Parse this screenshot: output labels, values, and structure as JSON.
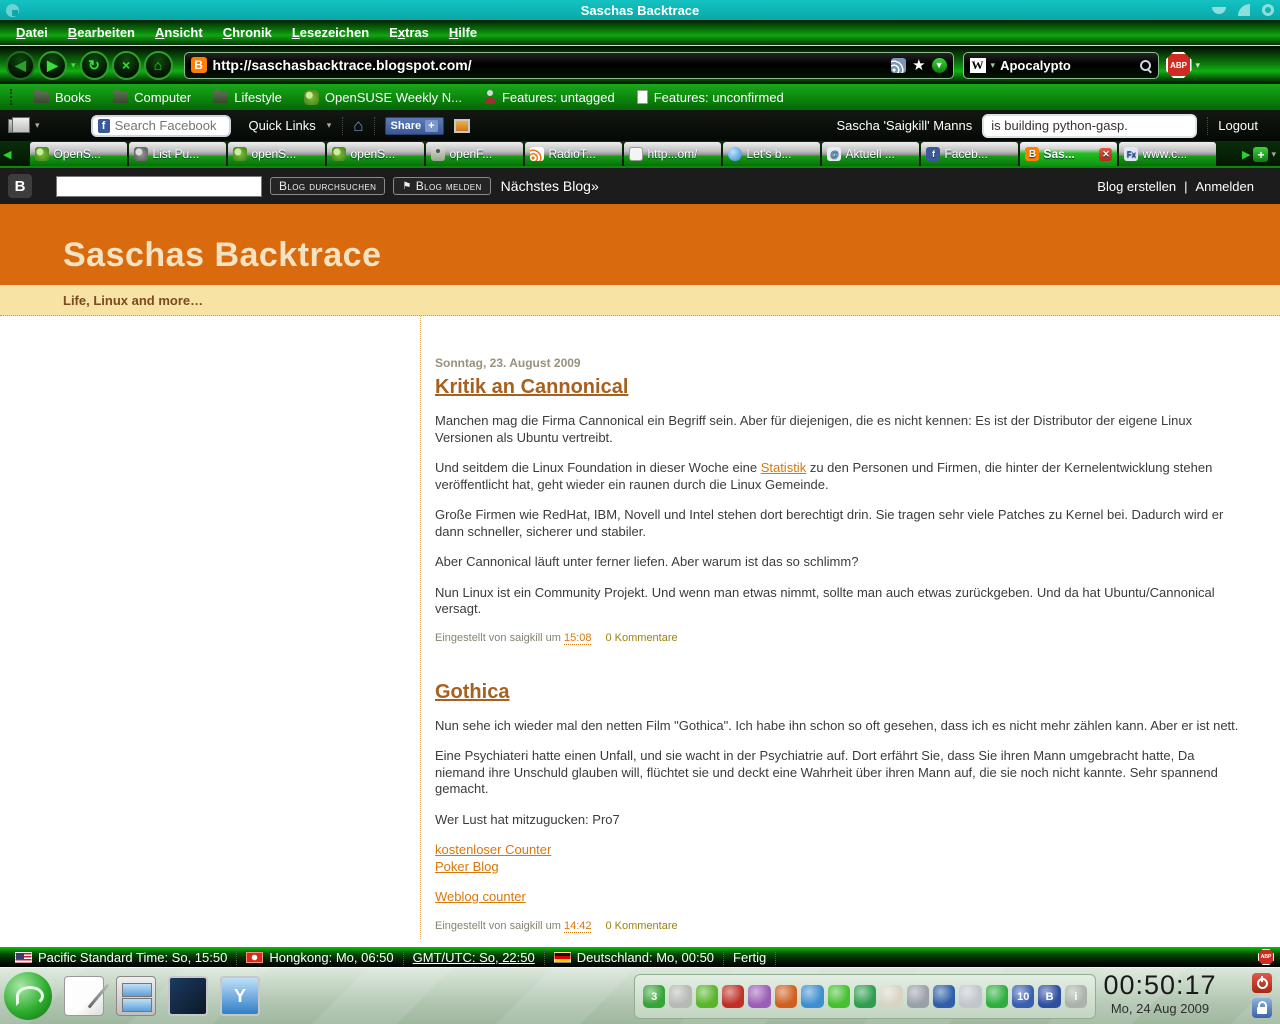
{
  "window": {
    "title": "Saschas Backtrace",
    "menus": [
      {
        "label": "Datei",
        "accel": 0
      },
      {
        "label": "Bearbeiten",
        "accel": 0
      },
      {
        "label": "Ansicht",
        "accel": 0
      },
      {
        "label": "Chronik",
        "accel": 0
      },
      {
        "label": "Lesezeichen",
        "accel": 0
      },
      {
        "label": "Extras",
        "accel": 1
      },
      {
        "label": "Hilfe",
        "accel": 0
      }
    ]
  },
  "nav": {
    "url": "http://saschasbacktrace.blogspot.com/",
    "search_engine": "W",
    "search_value": "Apocalypto",
    "abp_label": "ABP"
  },
  "bookmarks": [
    {
      "label": "Books",
      "icon": "folder"
    },
    {
      "label": "Computer",
      "icon": "folder"
    },
    {
      "label": "Lifestyle",
      "icon": "folder"
    },
    {
      "label": "OpenSUSE Weekly N...",
      "icon": "suse"
    },
    {
      "label": "Features: untagged",
      "icon": "person"
    },
    {
      "label": "Features: unconfirmed",
      "icon": "page"
    }
  ],
  "facebook_bar": {
    "search_placeholder": "Search Facebook",
    "quick_links": "Quick Links",
    "share": "Share",
    "plus": "+",
    "user": "Sascha 'Saigkill' Manns",
    "status_value": "is building python-gasp.",
    "logout": "Logout"
  },
  "tabs": [
    {
      "label": "OpenS...",
      "icon": "suse"
    },
    {
      "label": "List Pu...",
      "icon": "suse-gray"
    },
    {
      "label": "openS...",
      "icon": "suse"
    },
    {
      "label": "openS...",
      "icon": "suse"
    },
    {
      "label": "openF...",
      "icon": "fate"
    },
    {
      "label": "RadioT...",
      "icon": "rss"
    },
    {
      "label": "http...om/",
      "icon": "page"
    },
    {
      "label": "Let's b...",
      "icon": "globe"
    },
    {
      "label": "Aktuell ...",
      "icon": "chat",
      "glyph": "@"
    },
    {
      "label": "Faceb...",
      "icon": "facebook",
      "glyph": "f"
    },
    {
      "label": "Sas...",
      "icon": "blogger",
      "glyph": "B",
      "active": true
    },
    {
      "label": "www.c...",
      "icon": "fx",
      "glyph": "Fx"
    }
  ],
  "blogger_navbar": {
    "logo": "B",
    "search_value": "",
    "search_button": "Blog durchsuchen",
    "flag_glyph": "⚑",
    "flag_button": "Blog melden",
    "next_blog": "Nächstes Blog»",
    "create_blog": "Blog erstellen",
    "divider": "|",
    "sign_in": "Anmelden"
  },
  "blog": {
    "title": "Saschas Backtrace",
    "subtitle": "Life, Linux and more…",
    "posts": [
      {
        "date": "Sonntag, 23. August 2009",
        "title": "Kritik an Cannonical",
        "paragraphs": [
          [
            {
              "text": "Manchen mag die Firma Cannonical ein Begriff sein. Aber für diejenigen, die es nicht kennen: Es ist der Distributor der eigene Linux Versionen als Ubuntu vertreibt."
            }
          ],
          [
            {
              "text": "Und seitdem die Linux Foundation in dieser Woche eine "
            },
            {
              "text": "Statistik",
              "link": true
            },
            {
              "text": " zu den Personen und Firmen, die hinter der Kernelentwicklung stehen veröffentlicht hat, geht wieder ein raunen durch die Linux Gemeinde."
            }
          ],
          [
            {
              "text": "Große Firmen wie RedHat, IBM, Novell und Intel stehen dort berechtigt drin. Sie tragen sehr viele Patches zu Kernel bei. Dadurch wird er dann schneller, sicherer und stabiler."
            }
          ],
          [
            {
              "text": "Aber Cannonical läuft unter ferner liefen. Aber warum ist das so schlimm?"
            }
          ],
          [
            {
              "text": "Nun Linux ist ein Community Projekt. Und wenn man etwas nimmt, sollte man auch etwas zurückgeben. Und da hat Ubuntu/Cannonical versagt."
            }
          ]
        ],
        "footer": {
          "prefix": "Eingestellt von saigkill um",
          "time": "15:08",
          "comments": "0 Kommentare"
        }
      },
      {
        "date": "",
        "title": "Gothica",
        "paragraphs": [
          [
            {
              "text": "Nun sehe ich wieder mal den netten Film \"Gothica\". Ich habe ihn schon so oft gesehen, dass ich es nicht mehr zählen kann. Aber er ist nett."
            }
          ],
          [
            {
              "text": "Eine Psychiateri hatte einen Unfall, und sie wacht in der Psychiatrie auf. Dort erfährt Sie, dass Sie ihren Mann umgebracht hatte, Da niemand ihre Unschuld glauben will, flüchtet sie und deckt eine Wahrheit über ihren Mann auf, die sie noch nicht kannte. Sehr spannend gemacht."
            }
          ],
          [
            {
              "text": "Wer Lust hat mitzugucken: Pro7"
            }
          ],
          [
            {
              "text": "kostenloser Counter",
              "link": true
            },
            {
              "br": true
            },
            {
              "text": "Poker Blog",
              "link": true
            }
          ],
          [
            {
              "text": "Weblog counter",
              "link": true
            }
          ]
        ],
        "footer": {
          "prefix": "Eingestellt von saigkill um",
          "time": "14:42",
          "comments": "0 Kommentare"
        }
      }
    ]
  },
  "statusbar": {
    "items": [
      {
        "flag": "us",
        "text": "Pacific Standard Time: So, 15:50"
      },
      {
        "flag": "hk",
        "text": "Hongkong: Mo, 06:50"
      },
      {
        "flag": null,
        "text": "GMT/UTC: So, 22:50",
        "underline": true
      },
      {
        "flag": "de",
        "text": "Deutschland: Mo, 00:50"
      },
      {
        "flag": null,
        "text": "Fertig"
      }
    ],
    "abp_label": "ABP"
  },
  "taskbar": {
    "clock_time": "00:50:17",
    "clock_date": "Mo, 24 Aug 2009",
    "launchers": [
      {
        "name": "suse-menu-button"
      },
      {
        "name": "text-editor-icon"
      },
      {
        "name": "file-cabinet-icon"
      },
      {
        "name": "desktop-icon"
      },
      {
        "name": "usb-device-icon"
      }
    ],
    "tray": [
      {
        "name": "update-notifier-icon",
        "bg": "#37a437",
        "glyph": "3"
      },
      {
        "name": "volume-icon",
        "bg": "#b4bab4",
        "glyph": ""
      },
      {
        "name": "organizer-icon",
        "bg": "#59b52a",
        "glyph": ""
      },
      {
        "name": "media-player-icon",
        "bg": "#c03028",
        "glyph": ""
      },
      {
        "name": "power-manager-icon",
        "bg": "#9a5fb5",
        "glyph": ""
      },
      {
        "name": "browser-swirl-icon",
        "bg": "#d06020",
        "glyph": ""
      },
      {
        "name": "messenger-icon",
        "bg": "#3f8fd0",
        "glyph": ""
      },
      {
        "name": "skype-icon",
        "bg": "#45c030",
        "glyph": ""
      },
      {
        "name": "download-manager-icon",
        "bg": "#2f9e4f",
        "glyph": ""
      },
      {
        "name": "clipboard-icon",
        "bg": "#d8d4c4",
        "glyph": ""
      },
      {
        "name": "mic-pin-icon",
        "bg": "#9aa0a8",
        "glyph": ""
      },
      {
        "name": "network-icon",
        "bg": "#2f5fa8",
        "glyph": ""
      },
      {
        "name": "timer-icon",
        "bg": "#c0c6cc",
        "glyph": ""
      },
      {
        "name": "globe-icon",
        "bg": "#2fae3f",
        "glyph": ""
      },
      {
        "name": "torrent-icon",
        "bg": "#3a5fb0",
        "glyph": "10"
      },
      {
        "name": "b-app-icon",
        "bg": "#2f4f9f",
        "glyph": "B"
      },
      {
        "name": "info-icon",
        "bg": "#aab2aa",
        "glyph": "i"
      }
    ]
  }
}
